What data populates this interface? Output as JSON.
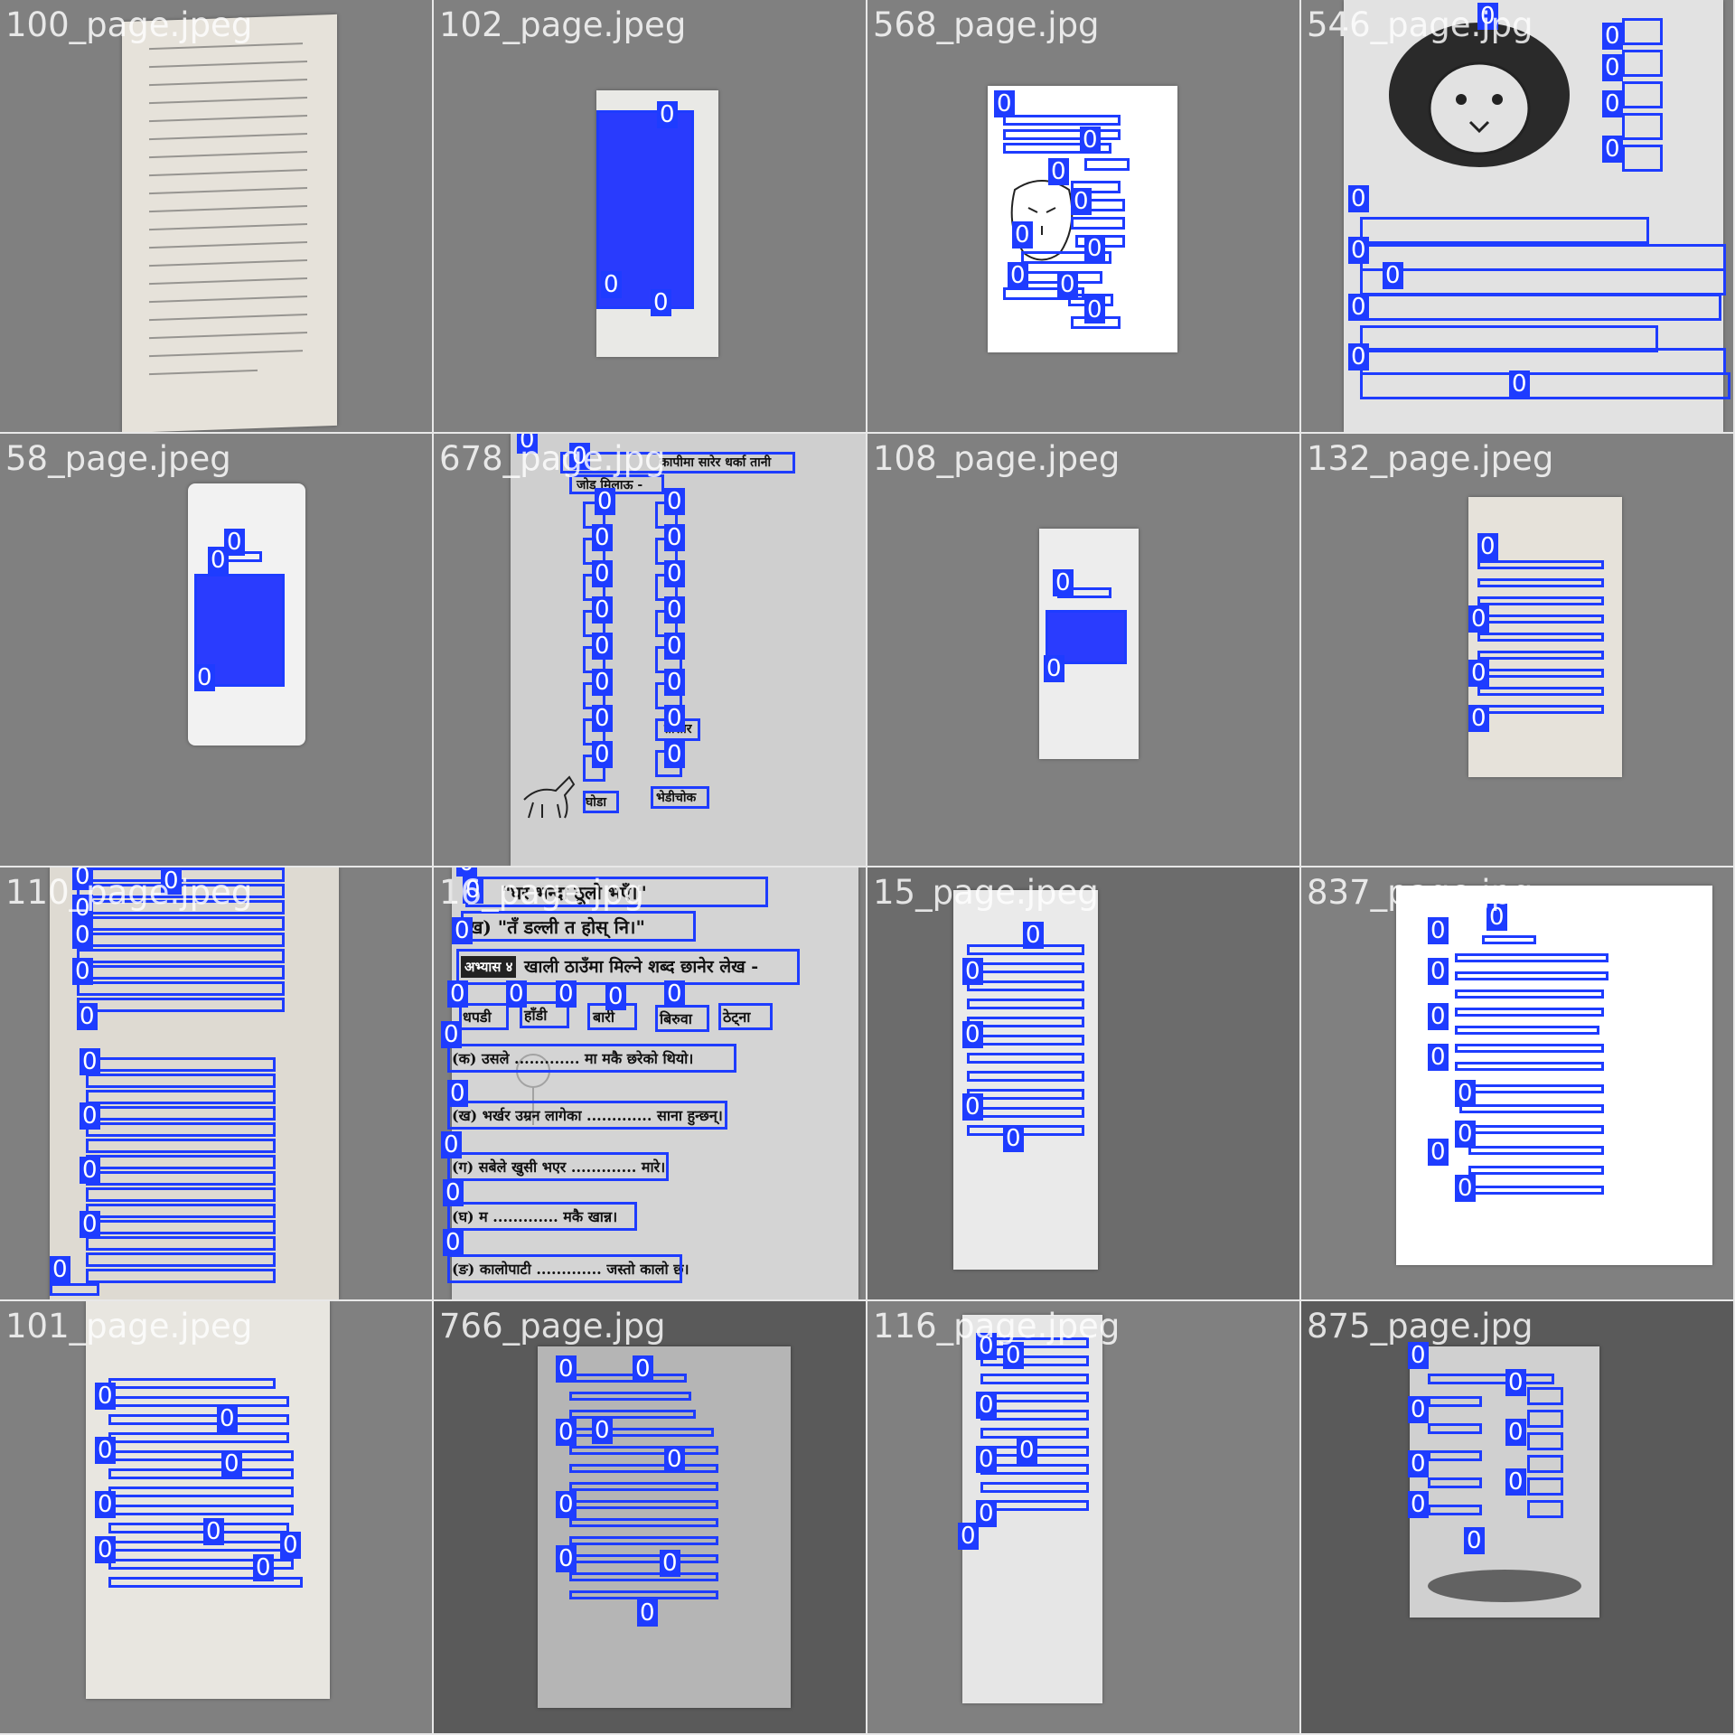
{
  "tiles": [
    {
      "name": "100_page.jpeg"
    },
    {
      "name": "102_page.jpeg"
    },
    {
      "name": "568_page.jpg"
    },
    {
      "name": "546_page.jpg"
    },
    {
      "name": "58_page.jpeg"
    },
    {
      "name": "678_page.jpg"
    },
    {
      "name": "108_page.jpeg"
    },
    {
      "name": "132_page.jpeg"
    },
    {
      "name": "110_page.jpeg"
    },
    {
      "name": "16_page.jpg"
    },
    {
      "name": "15_page.jpeg"
    },
    {
      "name": "837_page.jpg"
    },
    {
      "name": "101_page.jpeg"
    },
    {
      "name": "766_page.jpg"
    },
    {
      "name": "116_page.jpeg"
    },
    {
      "name": "875_page.jpg"
    }
  ],
  "class_label": "0",
  "tile_678": {
    "line1": "कापीमा सारेर धर्का तानी",
    "line2": "जोड मिलाऊ -",
    "bottom_left": "घोडा",
    "bottom_right": "भेडीचोक",
    "mid_right": "तीसार"
  },
  "tile_16": {
    "quote1": "\"घर भन्दा ठूलो भएँ।\"",
    "quote2": "ख) \"तँ डल्ली त होस् नि।\"",
    "heading_tag": "अभ्यास ४",
    "heading": "खाली ठाउँमा मिल्ने शब्द छानेर लेख -",
    "words": [
      "धपडी",
      "हाँडी",
      "बारी",
      "बिरुवा",
      "ठेट्ना"
    ],
    "sentences": [
      "(क) उसले ............. मा मकै छरेको थियो।",
      "(ख) भर्खर उम्रन लागेका ............. साना हुन्छन्।",
      "(ग) सबेले खुसी भएर ............. मारे।",
      "(घ) म ............. मकै खान्न।",
      "(ङ) कालोपाटी ............. जस्तो कालो छ।"
    ]
  },
  "colors": {
    "box": "#1e3cff",
    "background": "#7f7f7f",
    "grid_line": "#e8e8e8"
  }
}
